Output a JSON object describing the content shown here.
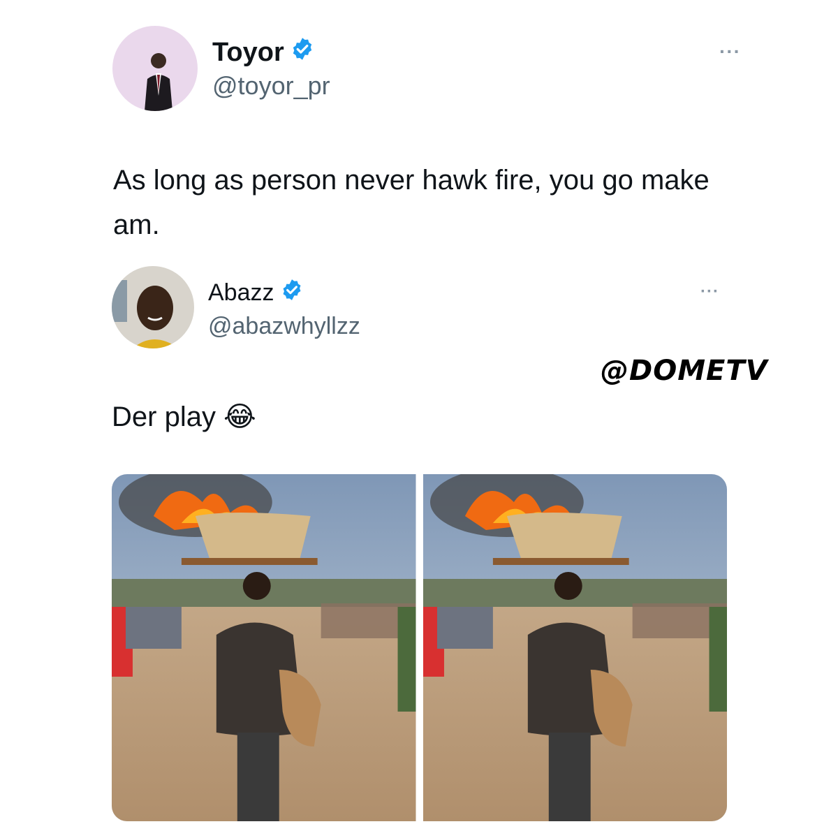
{
  "tweet1": {
    "author_name": "Toyor",
    "author_handle": "@toyor_pr",
    "verified_icon": "verified-badge-icon",
    "more_label": "···",
    "text": "As long as person never hawk fire, you go make am."
  },
  "tweet2": {
    "author_name": "Abazz",
    "author_handle": "@abazwhyllzz",
    "verified_icon": "verified-badge-icon",
    "more_label": "···",
    "text": "Der play 😂"
  },
  "watermark": "@DOMETV",
  "media": {
    "images": [
      {
        "description_icon": "man-carrying-burning-basin-photo"
      },
      {
        "description_icon": "man-carrying-burning-basin-photo"
      }
    ]
  },
  "colors": {
    "verified": "#1d9bf0",
    "text": "#0f1419",
    "secondary": "#536471"
  }
}
